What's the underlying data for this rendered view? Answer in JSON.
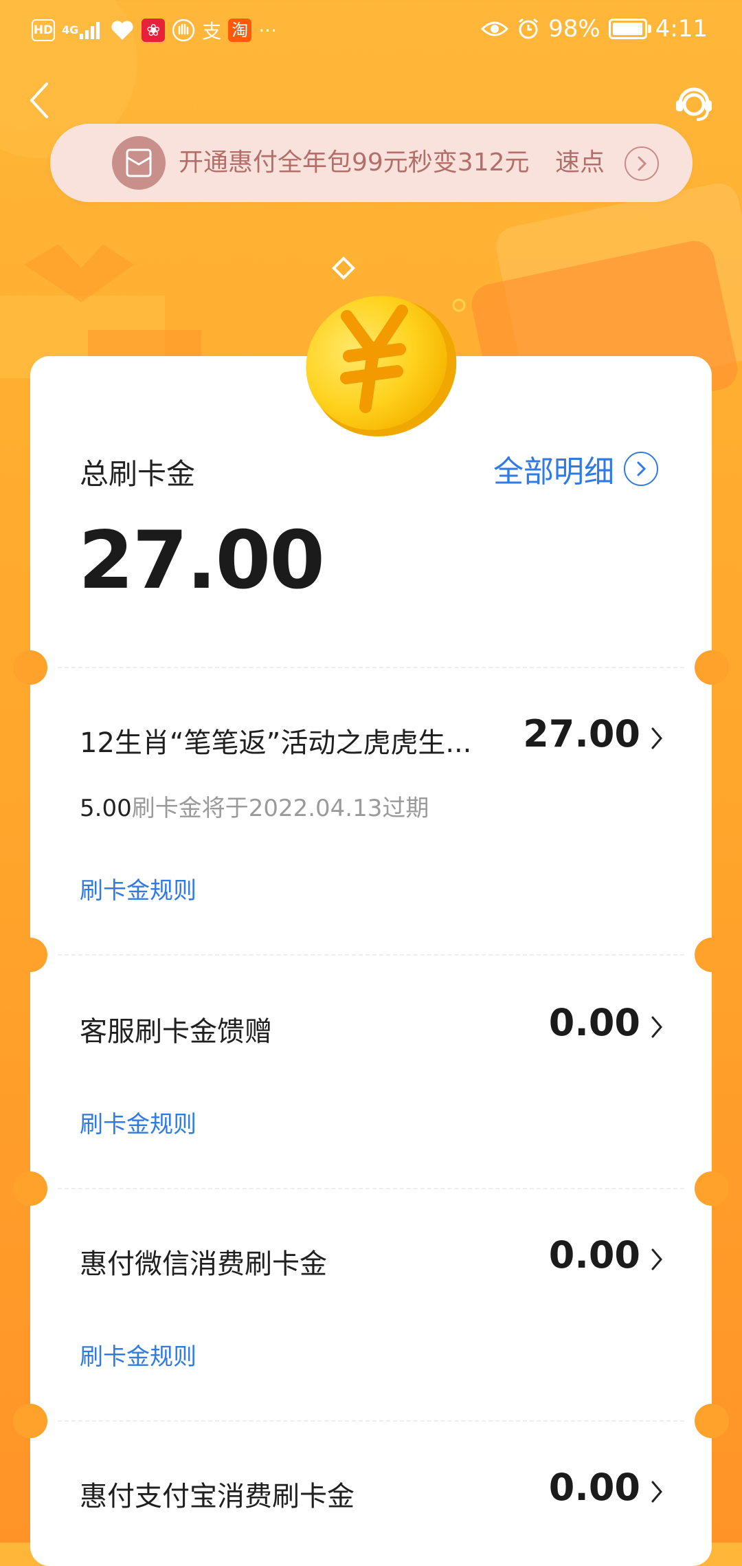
{
  "status_bar": {
    "hd": "HD",
    "net": "4G",
    "battery": "98%",
    "battery_level": 0.98,
    "time": "4:11",
    "more": "···",
    "alipay_glyph": "支",
    "taobao_glyph": "淘"
  },
  "promo": {
    "text": "开通惠付全年包99元秒变312元",
    "cta": "速点"
  },
  "summary": {
    "label": "总刷卡金",
    "amount": "27.00",
    "detail_link": "全部明细"
  },
  "items": [
    {
      "title": "12生肖“笔笔返”活动之虎虎生...",
      "amount": "27.00",
      "expire_amount": "5.00",
      "expire_text": "刷卡金将于2022.04.13过期",
      "rule": "刷卡金规则"
    },
    {
      "title": "客服刷卡金馈赠",
      "amount": "0.00",
      "rule": "刷卡金规则"
    },
    {
      "title": "惠付微信消费刷卡金",
      "amount": "0.00",
      "rule": "刷卡金规则"
    },
    {
      "title": "惠付支付宝消费刷卡金",
      "amount": "0.00"
    }
  ],
  "colors": {
    "background": "#ffaa2f",
    "link": "#2f7ae5",
    "promo_bg": "#f9e2dc",
    "promo_text": "#b36e6a",
    "coin": "#ffd21e"
  },
  "icons": [
    "back-arrow-icon",
    "customer-service-icon",
    "red-envelope-icon",
    "coin-yen-icon",
    "chevron-right-icon"
  ]
}
